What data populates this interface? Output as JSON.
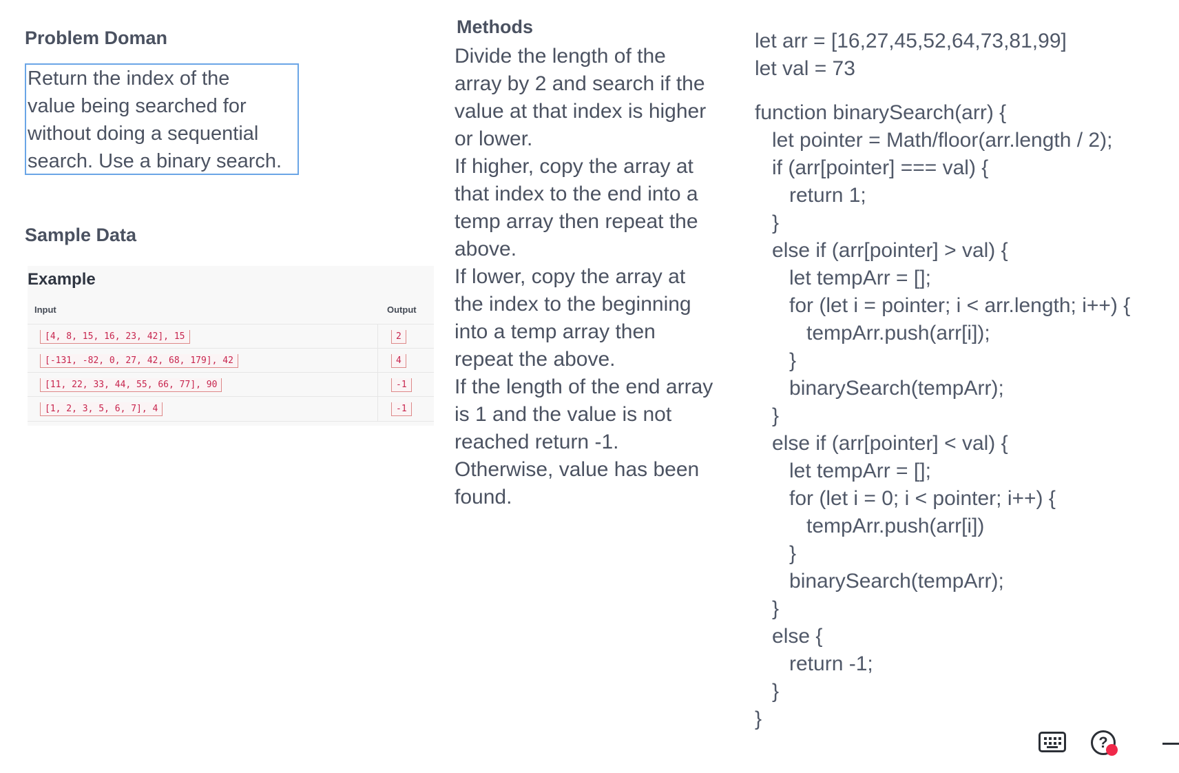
{
  "problem": {
    "title": "Problem Doman",
    "lines": [
      "Return the index of the",
      "value being searched for",
      "without doing a sequential",
      "search. Use a binary search."
    ]
  },
  "sample": {
    "title": "Sample Data",
    "example_title": "Example",
    "headers": {
      "input": "Input",
      "output": "Output"
    },
    "rows": [
      {
        "input": "[4, 8, 15, 16, 23, 42], 15",
        "output": "2"
      },
      {
        "input": "[-131, -82, 0, 27, 42, 68, 179], 42",
        "output": "4"
      },
      {
        "input": "[11, 22, 33, 44, 55, 66, 77], 90",
        "output": "-1"
      },
      {
        "input": "[1, 2, 3, 5, 6, 7], 4",
        "output": "-1"
      }
    ]
  },
  "methods": {
    "title": "Methods",
    "lines": [
      "Divide the length of the",
      "array by 2 and search if the",
      "value at that index is higher",
      "or lower.",
      "If higher, copy the array at",
      "that index to the end into a",
      "temp array then repeat the",
      "above.",
      "If lower, copy the array at",
      "the index to the beginning",
      "into a temp array then",
      "repeat the above.",
      "If the length of the end array",
      "is 1 and the value is not",
      "reached return -1.",
      "Otherwise, value has been",
      "found."
    ]
  },
  "code": {
    "lines": [
      "let arr = [16,27,45,52,64,73,81,99]",
      "let val = 73",
      "",
      "function binarySearch(arr) {",
      "   let pointer = Math/floor(arr.length / 2);",
      "   if (arr[pointer] === val) {",
      "      return 1;",
      "   }",
      "   else if (arr[pointer] > val) {",
      "      let tempArr = [];",
      "      for (let i = pointer; i < arr.length; i++) {",
      "         tempArr.push(arr[i]);",
      "      }",
      "      binarySearch(tempArr);",
      "   }",
      "   else if (arr[pointer] < val) {",
      "      let tempArr = [];",
      "      for (let i = 0; i < pointer; i++) {",
      "         tempArr.push(arr[i])",
      "      }",
      "      binarySearch(tempArr);",
      "   }",
      "   else {",
      "      return -1;",
      "   }",
      "}"
    ]
  },
  "toolbar": {
    "icons": [
      "keyboard-icon",
      "help-icon",
      "minimize-icon"
    ]
  }
}
